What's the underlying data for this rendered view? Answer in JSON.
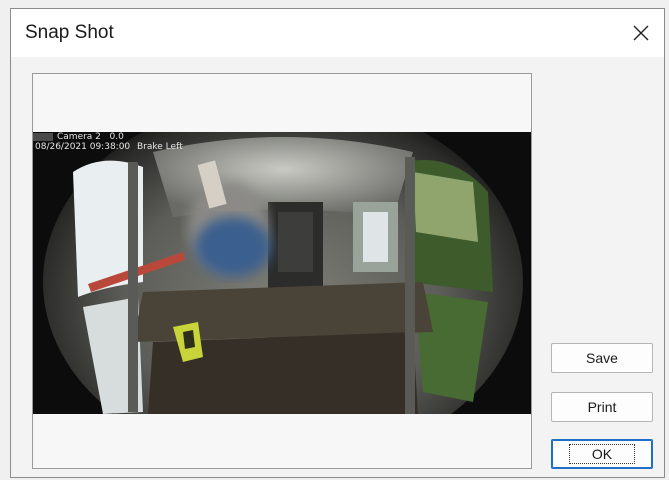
{
  "window": {
    "title": "Snap Shot"
  },
  "snapshot": {
    "camera_label": "Camera 2   0.0",
    "timestamp": "08/26/2021 09:38:00",
    "side_label": "Brake Left"
  },
  "buttons": {
    "save": "Save",
    "print": "Print",
    "ok": "OK"
  },
  "icons": {
    "close": "close-icon"
  },
  "colors": {
    "accent": "#1f6fc6"
  }
}
